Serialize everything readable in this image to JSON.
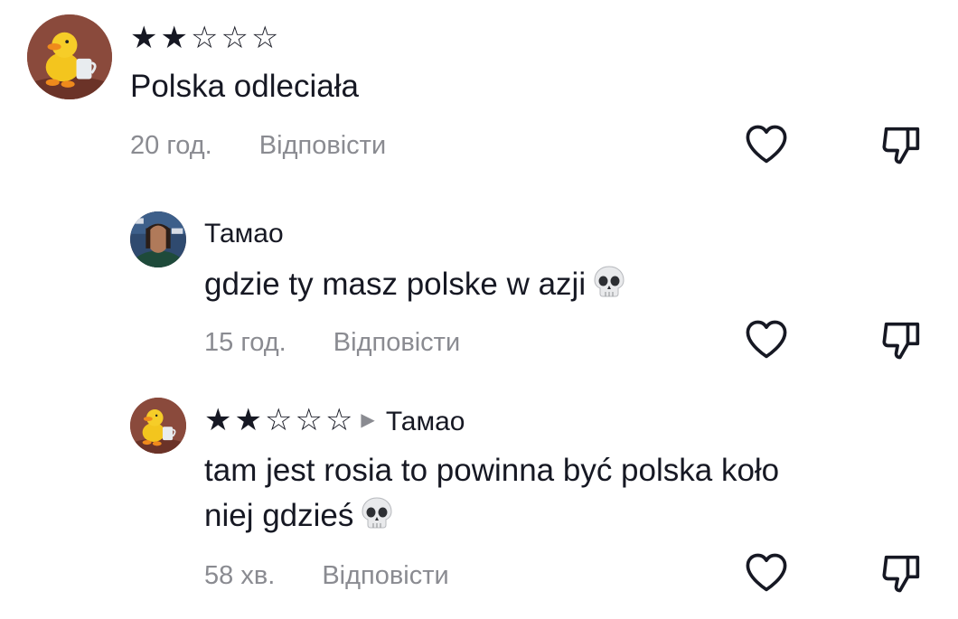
{
  "comments": [
    {
      "avatar": "duck-avatar",
      "rating": 2,
      "rating_max": 5,
      "text_lines": [
        "Polska odleciała"
      ],
      "time": "20 год.",
      "reply_label": "Відповісти"
    },
    {
      "avatar": "man-avatar",
      "username": "Тамао",
      "text_lines": [
        "gdzie ty masz polske w azji"
      ],
      "emoji": "skull-emoji",
      "time": "15 год.",
      "reply_label": "Відповісти"
    },
    {
      "avatar": "duck-avatar",
      "rating": 2,
      "rating_max": 5,
      "reply_to": "Тамао",
      "text_lines": [
        "tam jest rosia to powinna być polska koło",
        "niej gdzieś"
      ],
      "emoji": "skull-emoji",
      "time": "58 хв.",
      "reply_label": "Відповісти"
    }
  ],
  "icons": {
    "like": "heart-outline-icon",
    "dislike": "thumbs-down-outline-icon",
    "reply_arrow": "caret-right-icon",
    "star_filled": "★",
    "star_empty": "☆"
  },
  "colors": {
    "text": "#161823",
    "secondary": "#8a8b91",
    "background": "#ffffff"
  }
}
